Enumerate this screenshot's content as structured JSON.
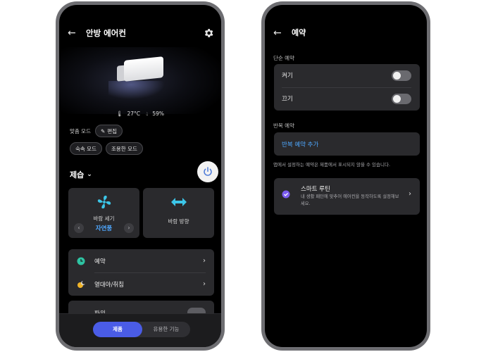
{
  "left": {
    "header": {
      "title": "안방 에어컨"
    },
    "readings": {
      "temperature": "27°C",
      "humidity": "59%"
    },
    "custom_mode": {
      "label": "맞춤 모드",
      "edit_label": "편집",
      "chips": [
        "숙속 모드",
        "조용한 모드"
      ]
    },
    "function": {
      "label": "제습"
    },
    "tiles": {
      "wind_strength": {
        "label": "바람 세기",
        "value": "자연풍"
      },
      "wind_direction": {
        "label": "바람 방향"
      }
    },
    "list": {
      "items": [
        "예약",
        "열대야/취침"
      ]
    },
    "peek": {
      "label": "파워"
    },
    "bottom_nav": {
      "tabs": [
        "제품",
        "유용한 기능"
      ],
      "active": "제품"
    }
  },
  "right": {
    "header": {
      "title": "예약"
    },
    "simple": {
      "label": "단순 예약",
      "rows": [
        "켜기",
        "끄기"
      ],
      "states": [
        false,
        false
      ]
    },
    "repeat": {
      "label": "반복 예약",
      "add_label": "반복 예약 추가"
    },
    "note": "앱에서 설정하는 예약은 제품에서 표시되지 않을 수 있습니다.",
    "routine": {
      "title": "스마트 루틴",
      "description": "내 생활 패턴에 맞추어 에어컨을 동작하도록 설정해보세요."
    }
  },
  "colors": {
    "accent_blue": "#4fa8ff",
    "segment_active": "#4a5ce6",
    "card_bg": "#2a2a2d",
    "fan_icon": "#3cc6e8",
    "routine_icon": "#7b5cf0"
  }
}
